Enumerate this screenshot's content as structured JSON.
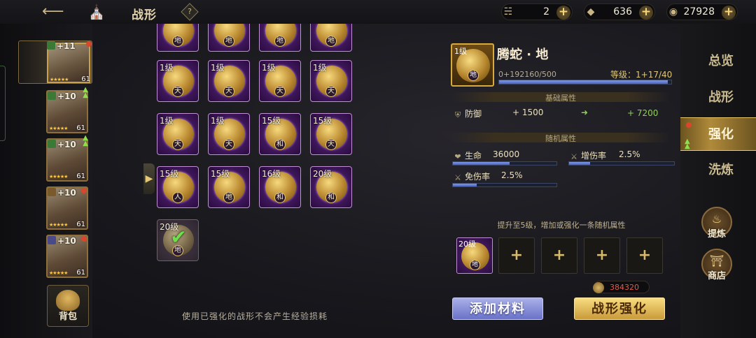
{
  "header": {
    "title": "战形",
    "help_icon": "?"
  },
  "resources": [
    {
      "icon": "scroll-icon",
      "value": "2"
    },
    {
      "icon": "gold-ingot-icon",
      "value": "636"
    },
    {
      "icon": "coin-icon",
      "value": "27928"
    }
  ],
  "heroes": [
    {
      "plus": "+11",
      "level": "61",
      "selected": true
    },
    {
      "plus": "+10",
      "level": "61"
    },
    {
      "plus": "+10",
      "level": "61"
    },
    {
      "plus": "+10",
      "level": "61"
    },
    {
      "plus": "+10",
      "level": "61"
    }
  ],
  "bag_label": "背包",
  "grid": {
    "rows": [
      [
        {
          "level": "",
          "tag": "地"
        },
        {
          "level": "",
          "tag": "地"
        },
        {
          "level": "",
          "tag": "地"
        },
        {
          "level": "",
          "tag": "地"
        }
      ],
      [
        {
          "level": "1级",
          "tag": "天"
        },
        {
          "level": "1级",
          "tag": "天"
        },
        {
          "level": "1级",
          "tag": "天"
        },
        {
          "level": "1级",
          "tag": "天"
        }
      ],
      [
        {
          "level": "1级",
          "tag": "天"
        },
        {
          "level": "1级",
          "tag": "天"
        },
        {
          "level": "15级",
          "tag": "和"
        },
        {
          "level": "15级",
          "tag": "天"
        }
      ],
      [
        {
          "level": "15级",
          "tag": "人"
        },
        {
          "level": "15级",
          "tag": "地"
        },
        {
          "level": "16级",
          "tag": "和"
        },
        {
          "level": "20级",
          "tag": "和"
        }
      ],
      [
        {
          "level": "20级",
          "tag": "地",
          "used": true
        }
      ]
    ],
    "note": "使用已强化的战形不会产生经验损耗"
  },
  "detail": {
    "icon_level": "1级",
    "icon_tag": "地",
    "name": "腾蛇 · 地",
    "xp": "0+192160/500",
    "grade": "等级：1+17/40",
    "xp_progress": 0.98,
    "base_header": "基础属性",
    "base_stat": {
      "name": "防御",
      "value": "+ 1500",
      "new_value": "+ 7200"
    },
    "random_header": "随机属性",
    "random_stats": [
      {
        "name": "生命",
        "value": "36000",
        "progress": 0.55
      },
      {
        "name": "增伤率",
        "value": "2.5%",
        "progress": 0.2
      },
      {
        "name": "免伤率",
        "value": "2.5%",
        "progress": 0.23
      }
    ],
    "hint": "提升至5级，增加或强化一条随机属性",
    "material": {
      "level": "20级",
      "tag": "地"
    },
    "cost": "384320",
    "add_button": "添加材料",
    "strengthen_button": "战形强化"
  },
  "nav": {
    "tabs": [
      "总览",
      "战形",
      "强化",
      "洗炼"
    ],
    "active": "强化",
    "refine_label": "提炼",
    "shop_label": "商店"
  },
  "colors": {
    "accent_gold": "#d8a93e",
    "purple_frame": "#c08fd6",
    "stat_green": "#8fd152",
    "cost_red": "#e05a4a"
  }
}
